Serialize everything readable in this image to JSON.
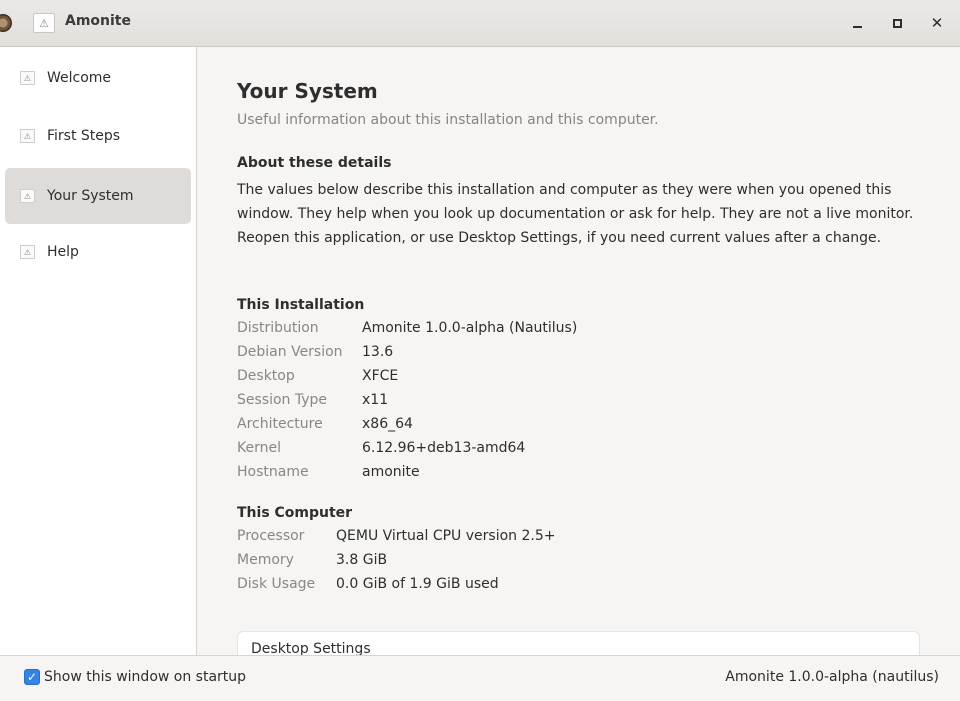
{
  "window": {
    "title": "Amonite",
    "icon": "app-logo-icon",
    "controls": {
      "minimize": "minimize-icon",
      "maximize": "maximize-icon",
      "close": "close-icon"
    }
  },
  "sidebar": {
    "items": [
      {
        "label": "Welcome",
        "icon": "page-icon",
        "active": false
      },
      {
        "label": "First Steps",
        "icon": "page-icon",
        "active": false
      },
      {
        "label": "Your System",
        "icon": "page-icon",
        "active": true
      },
      {
        "label": "Help",
        "icon": "page-icon",
        "active": false
      }
    ]
  },
  "main": {
    "title": "Your System",
    "subtitle": "Useful information about this installation and this computer.",
    "about": {
      "heading": "About these details",
      "text": "The values below describe this installation and computer as they were when you opened this window. They help when you look up documentation or ask for help. They are not a live monitor. Reopen this application, or use Desktop Settings, if you need current values after a change."
    },
    "installation": {
      "heading": "This Installation",
      "rows": [
        {
          "key": "Distribution",
          "value": "Amonite 1.0.0-alpha (Nautilus)"
        },
        {
          "key": "Debian Version",
          "value": "13.6"
        },
        {
          "key": "Desktop",
          "value": "XFCE"
        },
        {
          "key": "Session Type",
          "value": "x11"
        },
        {
          "key": "Architecture",
          "value": "x86_64"
        },
        {
          "key": "Kernel",
          "value": "6.12.96+deb13-amd64"
        },
        {
          "key": "Hostname",
          "value": "amonite"
        }
      ]
    },
    "computer": {
      "heading": "This Computer",
      "rows": [
        {
          "key": "Processor",
          "value": "QEMU Virtual CPU version 2.5+"
        },
        {
          "key": "Memory",
          "value": "3.8 GiB"
        },
        {
          "key": "Disk Usage",
          "value": "0.0 GiB of 1.9 GiB used"
        }
      ]
    },
    "settings_card": {
      "label": "Desktop Settings"
    }
  },
  "footer": {
    "startup_label": "Show this window on startup",
    "startup_checked": true,
    "version": "Amonite 1.0.0-alpha (nautilus)"
  },
  "colors": {
    "accent": "#3584e4",
    "sidebar_active": "#dedbd8",
    "muted_text": "#8a8682"
  }
}
